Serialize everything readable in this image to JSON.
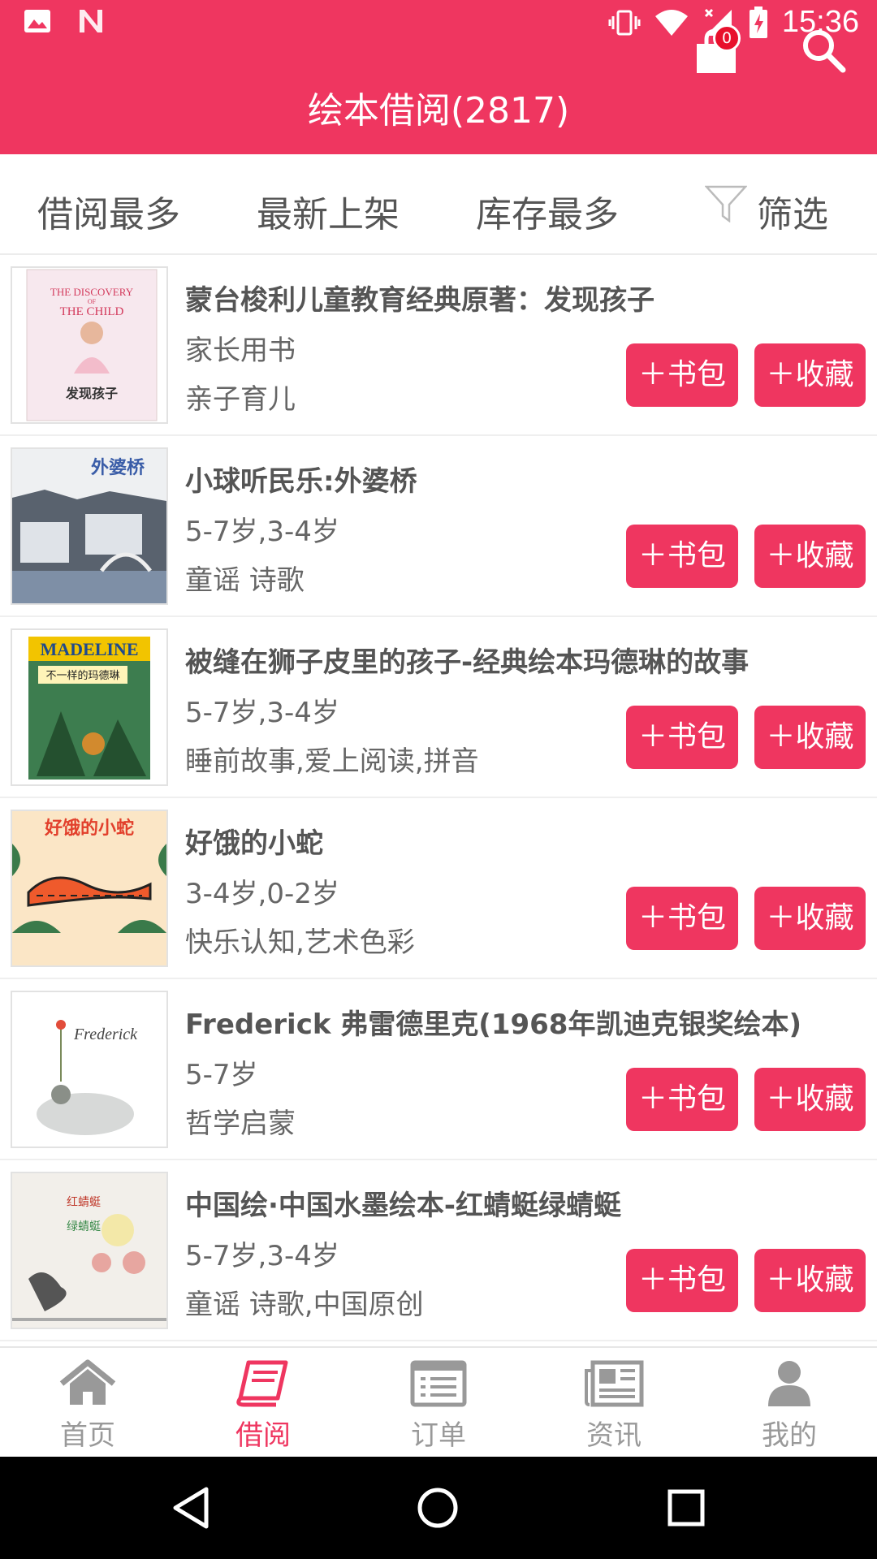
{
  "status_bar": {
    "time": "15:36"
  },
  "app_bar": {
    "title": "绘本借阅(2817)",
    "cart_count": "0"
  },
  "sort_tabs": [
    {
      "label": "借阅最多"
    },
    {
      "label": "最新上架"
    },
    {
      "label": "库存最多"
    },
    {
      "label": "筛选"
    }
  ],
  "books": [
    {
      "title": "蒙台梭利儿童教育经典原著：发现孩子",
      "age": "家长用书",
      "tags": "亲子育儿",
      "cover_text": [
        "THE DISCOVERY",
        "OF",
        "THE CHILD",
        "发现孩子"
      ]
    },
    {
      "title": "小球听民乐:外婆桥",
      "age": "5-7岁,3-4岁",
      "tags": "童谣 诗歌",
      "cover_text": [
        "外婆桥"
      ]
    },
    {
      "title": "被缝在狮子皮里的孩子-经典绘本玛德琳的故事",
      "age": "5-7岁,3-4岁",
      "tags": "睡前故事,爱上阅读,拼音",
      "cover_text": [
        "MADELINE",
        "不一样的玛德琳"
      ]
    },
    {
      "title": "好饿的小蛇",
      "age": "3-4岁,0-2岁",
      "tags": "快乐认知,艺术色彩",
      "cover_text": [
        "好饿的小蛇"
      ]
    },
    {
      "title": "Frederick 弗雷德里克(1968年凯迪克银奖绘本)",
      "age": "5-7岁",
      "tags": "哲学启蒙",
      "cover_text": [
        "Frederick"
      ]
    },
    {
      "title": "中国绘·中国水墨绘本-红蜻蜓绿蜻蜓",
      "age": "5-7岁,3-4岁",
      "tags": "童谣 诗歌,中国原创",
      "cover_text": [
        "红蜻蜓",
        "绿蜻蜓"
      ]
    }
  ],
  "buttons": {
    "add_bag": "＋书包",
    "add_fav": "＋收藏"
  },
  "bottom_nav": [
    {
      "label": "首页",
      "icon": "home-icon"
    },
    {
      "label": "借阅",
      "icon": "book-icon",
      "active": true
    },
    {
      "label": "订单",
      "icon": "order-list-icon"
    },
    {
      "label": "资讯",
      "icon": "news-icon"
    },
    {
      "label": "我的",
      "icon": "user-icon"
    }
  ],
  "colors": {
    "primary": "#ef3660",
    "text": "#555555",
    "muted": "#999999"
  }
}
